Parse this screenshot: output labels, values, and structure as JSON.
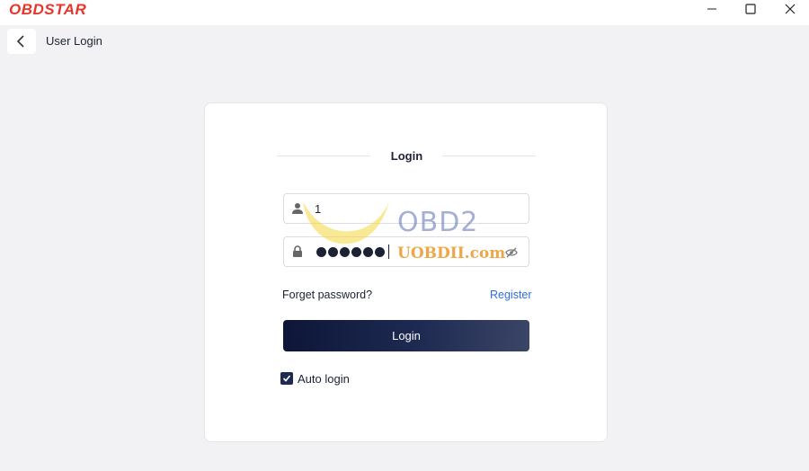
{
  "app": {
    "logo_text": "OBDSTAR",
    "brand_color": "#e8352b"
  },
  "window_controls": {
    "minimize_icon": "minimize-icon",
    "maximize_icon": "maximize-icon",
    "close_icon": "close-icon"
  },
  "header": {
    "back_icon": "chevron-left-icon",
    "title": "User Login"
  },
  "login_card": {
    "heading": "Login",
    "username": {
      "icon": "user-icon",
      "value": "1"
    },
    "password": {
      "icon": "lock-icon",
      "masked_length": 6,
      "toggle_icon": "eye-off-icon"
    },
    "forget_password_label": "Forget password?",
    "register_label": "Register",
    "login_button_label": "Login",
    "auto_login": {
      "label": "Auto login",
      "checked": true
    },
    "accent_color": "#2f6de1",
    "button_color": "#1e2a52"
  },
  "watermark": {
    "line1": "OBD2",
    "line2": "UOBDII.com"
  }
}
